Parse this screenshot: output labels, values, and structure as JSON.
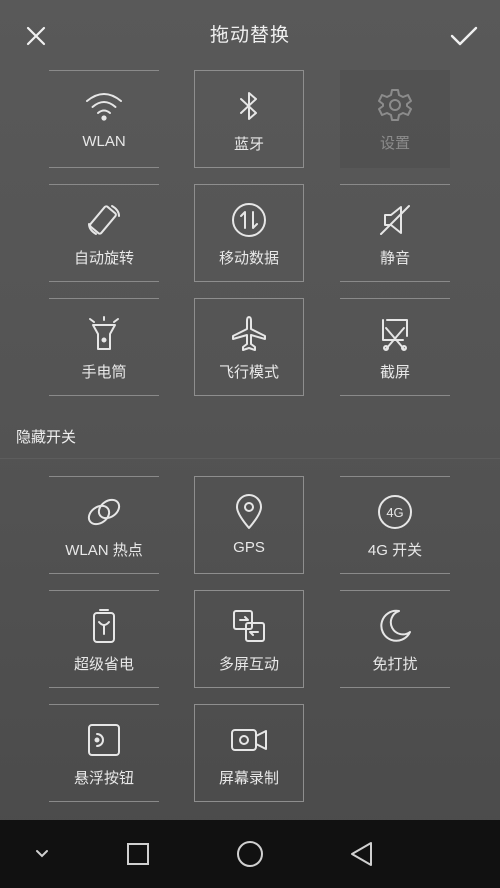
{
  "header": {
    "title": "拖动替换",
    "close_icon": "close-icon",
    "confirm_icon": "check-icon"
  },
  "active_tiles": [
    {
      "label": "WLAN",
      "icon": "wifi-icon"
    },
    {
      "label": "蓝牙",
      "icon": "bluetooth-icon"
    },
    {
      "label": "设置",
      "icon": "gear-icon",
      "state": "disabled"
    },
    {
      "label": "自动旋转",
      "icon": "auto-rotate-icon"
    },
    {
      "label": "移动数据",
      "icon": "mobile-data-icon"
    },
    {
      "label": "静音",
      "icon": "mute-icon"
    },
    {
      "label": "手电筒",
      "icon": "flashlight-icon"
    },
    {
      "label": "飞行模式",
      "icon": "airplane-icon"
    },
    {
      "label": "截屏",
      "icon": "screenshot-icon"
    }
  ],
  "hidden_section": {
    "title": "隐藏开关",
    "tiles": [
      {
        "label": "WLAN 热点",
        "icon": "hotspot-icon"
      },
      {
        "label": "GPS",
        "icon": "location-pin-icon"
      },
      {
        "label": "4G 开关",
        "icon": "4g-icon",
        "badge": "4G"
      },
      {
        "label": "超级省电",
        "icon": "battery-saver-icon"
      },
      {
        "label": "多屏互动",
        "icon": "multi-screen-icon"
      },
      {
        "label": "免打扰",
        "icon": "moon-icon"
      },
      {
        "label": "悬浮按钮",
        "icon": "floating-button-icon"
      },
      {
        "label": "屏幕录制",
        "icon": "screen-record-icon"
      }
    ]
  },
  "navbar": {
    "icons": [
      "chevron-down-icon",
      "recents-square-icon",
      "home-circle-icon",
      "back-triangle-icon"
    ]
  }
}
